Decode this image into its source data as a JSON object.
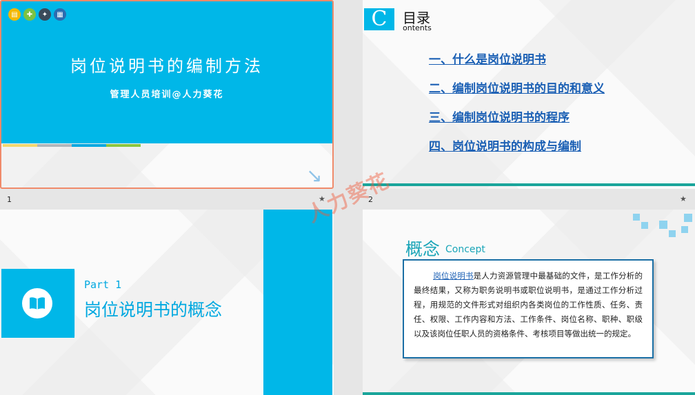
{
  "slides": [
    {
      "number": "1",
      "title": "岗位说明书的编制方法",
      "subtitle": "管理人员培训@人力葵花"
    },
    {
      "number": "2",
      "toc_letter": "C",
      "toc_title": "目录",
      "toc_sub": "ontents",
      "items": [
        "一、什么是岗位说明书",
        "二、编制岗位说明书的目的和意义",
        "三、编制岗位说明书的程序",
        "四、岗位说明书的构成与编制"
      ]
    },
    {
      "part": "Part 1",
      "title": "岗位说明书的概念"
    },
    {
      "title": "概念",
      "title_en": "Concept",
      "keyword": "岗位说明书",
      "body": "是人力资源管理中最基础的文件，是工作分析的最终结果，又称为职务说明书或职位说明书，是通过工作分析过程，用规范的文件形式对组织内各类岗位的工作性质、任务、责任、权限、工作内容和方法、工作条件、岗位名称、职种、职级以及该岗位任职人员的资格条件、考核项目等做出统一的规定。"
    }
  ],
  "watermark": "人力葵花",
  "colors": {
    "accent": "#00b7e8",
    "link": "#1a5fb4",
    "teal": "#1aa59b",
    "selection": "#f08a6a"
  }
}
